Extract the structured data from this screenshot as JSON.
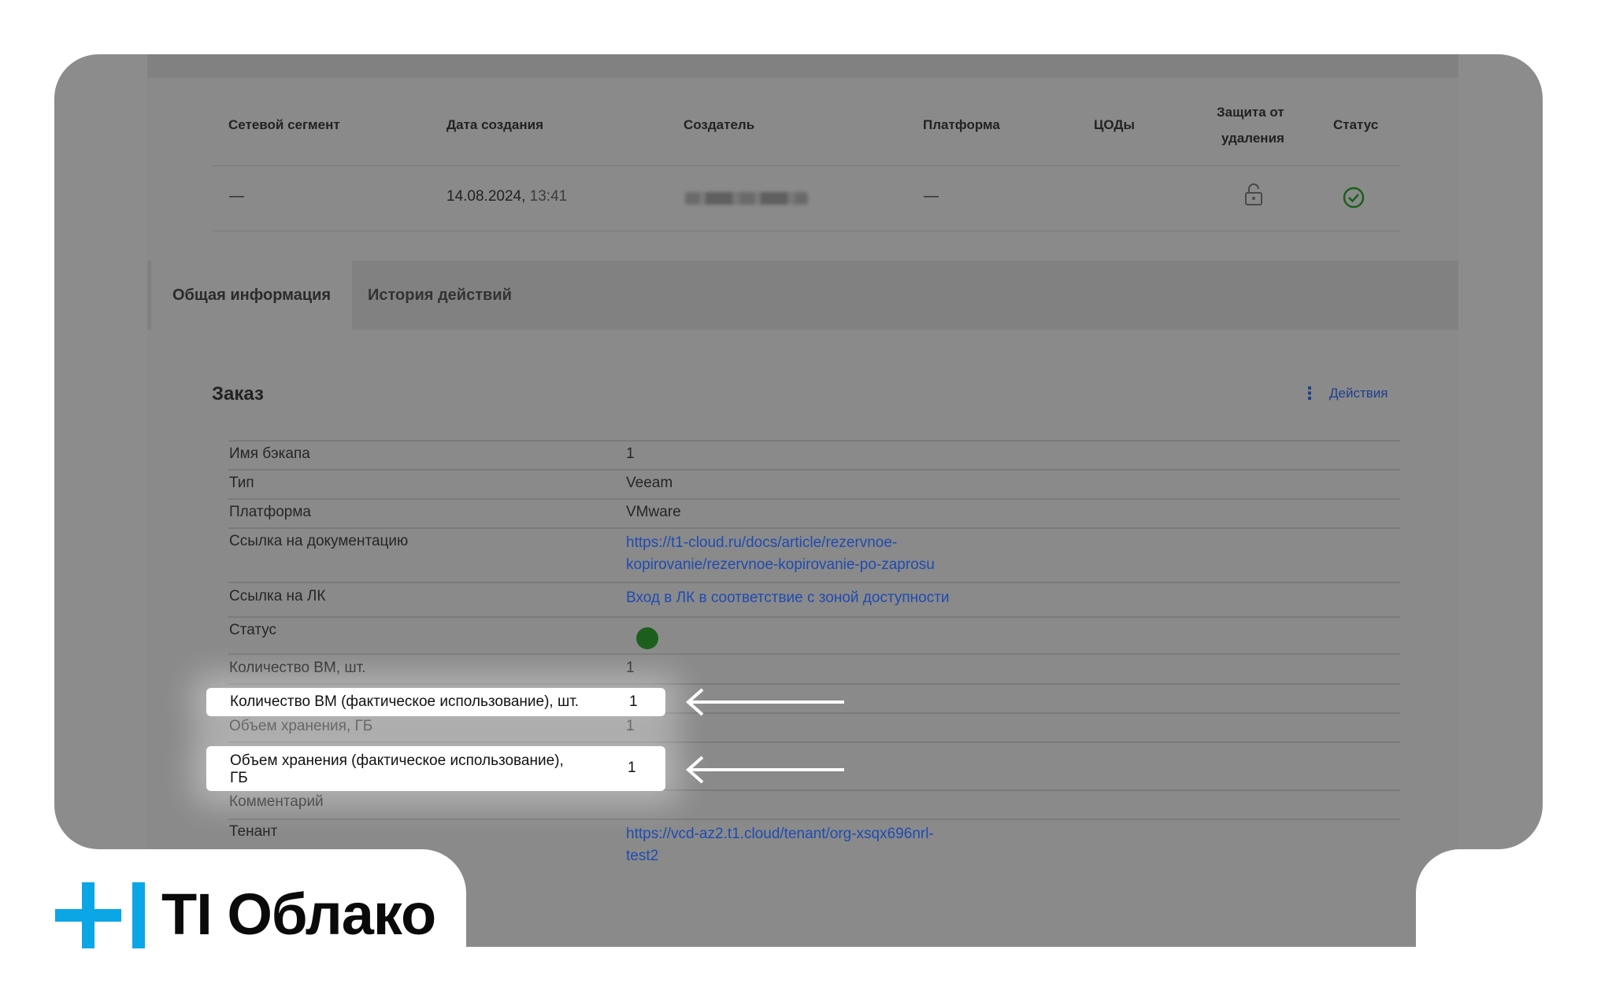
{
  "meta": {
    "headers": {
      "segment": "Сетевой сегмент",
      "created": "Дата создания",
      "creator": "Создатель",
      "platform": "Платформа",
      "dc": "ЦОДы",
      "protection_line1": "Защита от",
      "protection_line2": "удаления",
      "status": "Статус"
    },
    "values": {
      "segment": "—",
      "created_date": "14.08.2024,",
      "created_time": "13:41",
      "platform": "—"
    }
  },
  "tabs": [
    {
      "label": "Общая информация",
      "active": true
    },
    {
      "label": "История действий",
      "active": false
    }
  ],
  "order": {
    "title": "Заказ",
    "actions_label": "Действия",
    "rows": [
      {
        "label": "Имя бэкапа",
        "value": "1"
      },
      {
        "label": "Тип",
        "value": "Veeam"
      },
      {
        "label": "Платформа",
        "value": "VMware"
      },
      {
        "label": "Ссылка на документацию",
        "value_line1": "https://t1-cloud.ru/docs/article/rezervnoe-",
        "value_line2": "kopirovanie/rezervnoe-kopirovanie-po-zaprosu"
      },
      {
        "label": "Ссылка на ЛК",
        "value": "Вход в ЛК в соответствие с зоной доступности"
      },
      {
        "label": "Статус",
        "status_color": "#1c5f1c"
      },
      {
        "label": "Количество ВМ, шт.",
        "value": "1"
      },
      {
        "label": "Количество ВМ (фактическое использование), шт.",
        "value": "1"
      },
      {
        "label": "Объем хранения, ГБ",
        "value": "1"
      },
      {
        "label_line1": "Объем хранения (фактическое использование),",
        "label_line2": "ГБ",
        "value": "1"
      },
      {
        "label": "Комментарий",
        "value": ""
      },
      {
        "label": "Тенант",
        "value_line1": "https://vcd-az2.t1.cloud/tenant/org-xsqx696nrl-",
        "value_line2": "test2"
      }
    ]
  },
  "brand": {
    "name": "TI Облако",
    "accent": "#0aa6e6"
  },
  "icons": {
    "lock": "unlock-icon",
    "status": "check-circle-icon",
    "actions": "vertical-dots-icon",
    "arrow": "left-arrow-icon"
  }
}
